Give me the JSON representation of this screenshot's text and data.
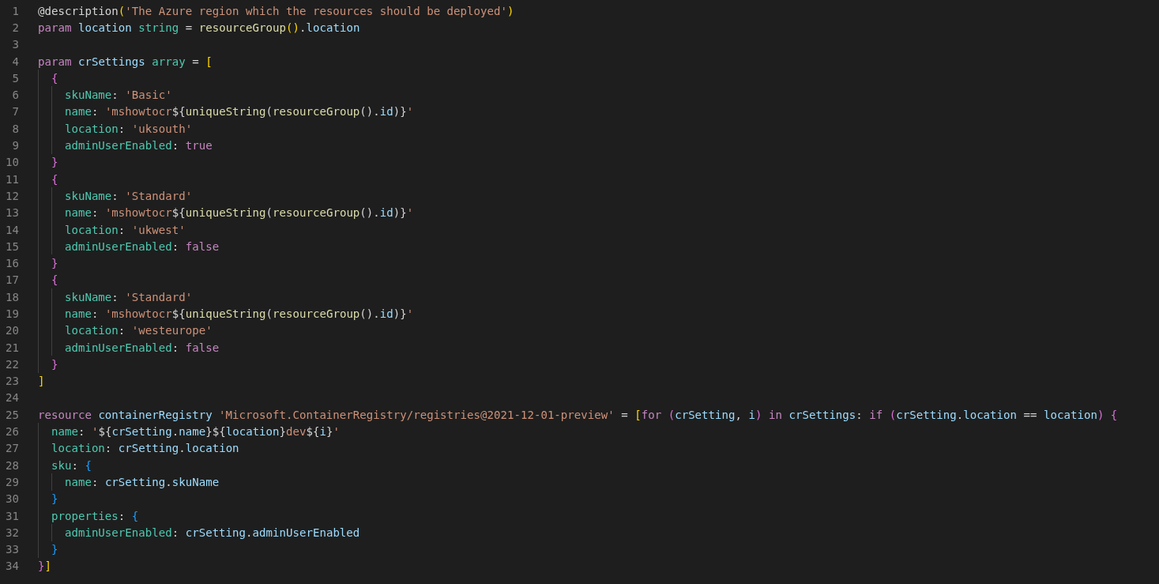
{
  "editor": {
    "lines": [
      {
        "number": "1",
        "tokens": [
          {
            "kind": "p",
            "text": "@description"
          },
          {
            "kind": "b1",
            "text": "("
          },
          {
            "kind": "str",
            "text": "'The Azure region which the resources should be deployed'"
          },
          {
            "kind": "b1",
            "text": ")"
          }
        ]
      },
      {
        "number": "2",
        "tokens": [
          {
            "kind": "kw",
            "text": "param "
          },
          {
            "kind": "var",
            "text": "location "
          },
          {
            "kind": "type",
            "text": "string"
          },
          {
            "kind": "p",
            "text": " = "
          },
          {
            "kind": "fn",
            "text": "resourceGroup"
          },
          {
            "kind": "b1",
            "text": "()"
          },
          {
            "kind": "p",
            "text": "."
          },
          {
            "kind": "var",
            "text": "location"
          }
        ]
      },
      {
        "number": "3"
      },
      {
        "number": "4",
        "tokens": [
          {
            "kind": "kw",
            "text": "param "
          },
          {
            "kind": "var",
            "text": "crSettings "
          },
          {
            "kind": "type",
            "text": "array"
          },
          {
            "kind": "p",
            "text": " = "
          },
          {
            "kind": "b1",
            "text": "["
          }
        ],
        "children": [
          {
            "number": "5",
            "tokens": [
              {
                "kind": "b2",
                "text": "{"
              }
            ],
            "children": [
              {
                "number": "6",
                "tokens": [
                  {
                    "kind": "prop",
                    "text": "skuName"
                  },
                  {
                    "kind": "p",
                    "text": ": "
                  },
                  {
                    "kind": "str",
                    "text": "'Basic'"
                  }
                ]
              },
              {
                "number": "7",
                "tokens": [
                  {
                    "kind": "prop",
                    "text": "name"
                  },
                  {
                    "kind": "p",
                    "text": ": "
                  },
                  {
                    "kind": "str",
                    "text": "'mshowtocr"
                  },
                  {
                    "kind": "p",
                    "text": "${"
                  },
                  {
                    "kind": "fn",
                    "text": "uniqueString"
                  },
                  {
                    "kind": "p",
                    "text": "("
                  },
                  {
                    "kind": "fn",
                    "text": "resourceGroup"
                  },
                  {
                    "kind": "p",
                    "text": "()."
                  },
                  {
                    "kind": "var",
                    "text": "id"
                  },
                  {
                    "kind": "p",
                    "text": ")}"
                  },
                  {
                    "kind": "str",
                    "text": "'"
                  }
                ]
              },
              {
                "number": "8",
                "tokens": [
                  {
                    "kind": "prop",
                    "text": "location"
                  },
                  {
                    "kind": "p",
                    "text": ": "
                  },
                  {
                    "kind": "str",
                    "text": "'uksouth'"
                  }
                ]
              },
              {
                "number": "9",
                "tokens": [
                  {
                    "kind": "prop",
                    "text": "adminUserEnabled"
                  },
                  {
                    "kind": "p",
                    "text": ": "
                  },
                  {
                    "kind": "kw",
                    "text": "true"
                  }
                ]
              }
            ]
          },
          {
            "number": "10",
            "tokens": [
              {
                "kind": "b2",
                "text": "}"
              }
            ]
          },
          {
            "number": "11",
            "tokens": [
              {
                "kind": "b2",
                "text": "{"
              }
            ],
            "children": [
              {
                "number": "12",
                "tokens": [
                  {
                    "kind": "prop",
                    "text": "skuName"
                  },
                  {
                    "kind": "p",
                    "text": ": "
                  },
                  {
                    "kind": "str",
                    "text": "'Standard'"
                  }
                ]
              },
              {
                "number": "13",
                "tokens": [
                  {
                    "kind": "prop",
                    "text": "name"
                  },
                  {
                    "kind": "p",
                    "text": ": "
                  },
                  {
                    "kind": "str",
                    "text": "'mshowtocr"
                  },
                  {
                    "kind": "p",
                    "text": "${"
                  },
                  {
                    "kind": "fn",
                    "text": "uniqueString"
                  },
                  {
                    "kind": "p",
                    "text": "("
                  },
                  {
                    "kind": "fn",
                    "text": "resourceGroup"
                  },
                  {
                    "kind": "p",
                    "text": "()."
                  },
                  {
                    "kind": "var",
                    "text": "id"
                  },
                  {
                    "kind": "p",
                    "text": ")}"
                  },
                  {
                    "kind": "str",
                    "text": "'"
                  }
                ]
              },
              {
                "number": "14",
                "tokens": [
                  {
                    "kind": "prop",
                    "text": "location"
                  },
                  {
                    "kind": "p",
                    "text": ": "
                  },
                  {
                    "kind": "str",
                    "text": "'ukwest'"
                  }
                ]
              },
              {
                "number": "15",
                "tokens": [
                  {
                    "kind": "prop",
                    "text": "adminUserEnabled"
                  },
                  {
                    "kind": "p",
                    "text": ": "
                  },
                  {
                    "kind": "kw",
                    "text": "false"
                  }
                ]
              }
            ]
          },
          {
            "number": "16",
            "tokens": [
              {
                "kind": "b2",
                "text": "}"
              }
            ]
          },
          {
            "number": "17",
            "tokens": [
              {
                "kind": "b2",
                "text": "{"
              }
            ],
            "children": [
              {
                "number": "18",
                "tokens": [
                  {
                    "kind": "prop",
                    "text": "skuName"
                  },
                  {
                    "kind": "p",
                    "text": ": "
                  },
                  {
                    "kind": "str",
                    "text": "'Standard'"
                  }
                ]
              },
              {
                "number": "19",
                "tokens": [
                  {
                    "kind": "prop",
                    "text": "name"
                  },
                  {
                    "kind": "p",
                    "text": ": "
                  },
                  {
                    "kind": "str",
                    "text": "'mshowtocr"
                  },
                  {
                    "kind": "p",
                    "text": "${"
                  },
                  {
                    "kind": "fn",
                    "text": "uniqueString"
                  },
                  {
                    "kind": "p",
                    "text": "("
                  },
                  {
                    "kind": "fn",
                    "text": "resourceGroup"
                  },
                  {
                    "kind": "p",
                    "text": "()."
                  },
                  {
                    "kind": "var",
                    "text": "id"
                  },
                  {
                    "kind": "p",
                    "text": ")}"
                  },
                  {
                    "kind": "str",
                    "text": "'"
                  }
                ]
              },
              {
                "number": "20",
                "tokens": [
                  {
                    "kind": "prop",
                    "text": "location"
                  },
                  {
                    "kind": "p",
                    "text": ": "
                  },
                  {
                    "kind": "str",
                    "text": "'westeurope'"
                  }
                ]
              },
              {
                "number": "21",
                "tokens": [
                  {
                    "kind": "prop",
                    "text": "adminUserEnabled"
                  },
                  {
                    "kind": "p",
                    "text": ": "
                  },
                  {
                    "kind": "kw",
                    "text": "false"
                  }
                ]
              }
            ]
          },
          {
            "number": "22",
            "tokens": [
              {
                "kind": "b2",
                "text": "}"
              }
            ]
          }
        ]
      },
      {
        "number": "23",
        "tokens": [
          {
            "kind": "b1",
            "text": "]"
          }
        ]
      },
      {
        "number": "24"
      },
      {
        "number": "25",
        "tokens": [
          {
            "kind": "kw",
            "text": "resource "
          },
          {
            "kind": "var",
            "text": "containerRegistry "
          },
          {
            "kind": "str",
            "text": "'Microsoft.ContainerRegistry/registries@2021-12-01-preview'"
          },
          {
            "kind": "p",
            "text": " = "
          },
          {
            "kind": "b1",
            "text": "["
          },
          {
            "kind": "kw",
            "text": "for "
          },
          {
            "kind": "b2",
            "text": "("
          },
          {
            "kind": "var",
            "text": "crSetting"
          },
          {
            "kind": "p",
            "text": ", "
          },
          {
            "kind": "var",
            "text": "i"
          },
          {
            "kind": "b2",
            "text": ")"
          },
          {
            "kind": "kw",
            "text": " in "
          },
          {
            "kind": "var",
            "text": "crSettings"
          },
          {
            "kind": "p",
            "text": ": "
          },
          {
            "kind": "kw",
            "text": "if "
          },
          {
            "kind": "b2",
            "text": "("
          },
          {
            "kind": "var",
            "text": "crSetting"
          },
          {
            "kind": "p",
            "text": "."
          },
          {
            "kind": "var",
            "text": "location"
          },
          {
            "kind": "p",
            "text": " == "
          },
          {
            "kind": "var",
            "text": "location"
          },
          {
            "kind": "b2",
            "text": ") {"
          }
        ],
        "children": [
          {
            "number": "26",
            "tokens": [
              {
                "kind": "prop",
                "text": "name"
              },
              {
                "kind": "p",
                "text": ": "
              },
              {
                "kind": "str",
                "text": "'"
              },
              {
                "kind": "p",
                "text": "${"
              },
              {
                "kind": "var",
                "text": "crSetting"
              },
              {
                "kind": "p",
                "text": "."
              },
              {
                "kind": "var",
                "text": "name"
              },
              {
                "kind": "p",
                "text": "}${"
              },
              {
                "kind": "var",
                "text": "location"
              },
              {
                "kind": "p",
                "text": "}"
              },
              {
                "kind": "str",
                "text": "dev"
              },
              {
                "kind": "p",
                "text": "${"
              },
              {
                "kind": "var",
                "text": "i"
              },
              {
                "kind": "p",
                "text": "}"
              },
              {
                "kind": "str",
                "text": "'"
              }
            ]
          },
          {
            "number": "27",
            "tokens": [
              {
                "kind": "prop",
                "text": "location"
              },
              {
                "kind": "p",
                "text": ": "
              },
              {
                "kind": "var",
                "text": "crSetting"
              },
              {
                "kind": "p",
                "text": "."
              },
              {
                "kind": "var",
                "text": "location"
              }
            ]
          },
          {
            "number": "28",
            "tokens": [
              {
                "kind": "prop",
                "text": "sku"
              },
              {
                "kind": "p",
                "text": ": "
              },
              {
                "kind": "b3",
                "text": "{"
              }
            ],
            "children": [
              {
                "number": "29",
                "tokens": [
                  {
                    "kind": "prop",
                    "text": "name"
                  },
                  {
                    "kind": "p",
                    "text": ": "
                  },
                  {
                    "kind": "var",
                    "text": "crSetting"
                  },
                  {
                    "kind": "p",
                    "text": "."
                  },
                  {
                    "kind": "var",
                    "text": "skuName"
                  }
                ]
              }
            ]
          },
          {
            "number": "30",
            "tokens": [
              {
                "kind": "b3",
                "text": "}"
              }
            ]
          },
          {
            "number": "31",
            "tokens": [
              {
                "kind": "prop",
                "text": "properties"
              },
              {
                "kind": "p",
                "text": ": "
              },
              {
                "kind": "b3",
                "text": "{"
              }
            ],
            "children": [
              {
                "number": "32",
                "tokens": [
                  {
                    "kind": "prop",
                    "text": "adminUserEnabled"
                  },
                  {
                    "kind": "p",
                    "text": ": "
                  },
                  {
                    "kind": "var",
                    "text": "crSetting"
                  },
                  {
                    "kind": "p",
                    "text": "."
                  },
                  {
                    "kind": "var",
                    "text": "adminUserEnabled"
                  }
                ]
              }
            ]
          },
          {
            "number": "33",
            "tokens": [
              {
                "kind": "b3",
                "text": "}"
              }
            ]
          }
        ]
      },
      {
        "number": "34",
        "tokens": [
          {
            "kind": "b2",
            "text": "}"
          },
          {
            "kind": "b1",
            "text": "]"
          }
        ]
      }
    ]
  }
}
